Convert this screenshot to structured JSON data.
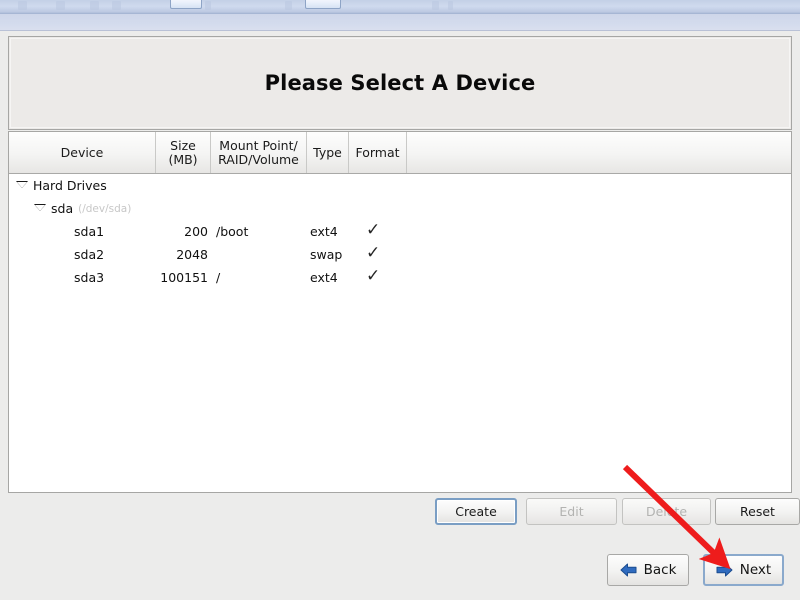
{
  "window": {
    "title": "Please Select A Device"
  },
  "chrome": {
    "present": true
  },
  "table": {
    "columns": [
      {
        "label": "Device",
        "key": "device"
      },
      {
        "label": "Size\n(MB)",
        "line1": "Size",
        "line2": "(MB)",
        "key": "size"
      },
      {
        "label": "Mount Point/\nRAID/Volume",
        "line1": "Mount Point/",
        "line2": "RAID/Volume",
        "key": "mount"
      },
      {
        "label": "Type",
        "key": "type"
      },
      {
        "label": "Format",
        "key": "format"
      }
    ],
    "rows": [
      {
        "kind": "group",
        "indent": 0,
        "expanded": true,
        "device": "Hard Drives",
        "path": "",
        "size": "",
        "mount": "",
        "type": "",
        "format": ""
      },
      {
        "kind": "disk",
        "indent": 1,
        "expanded": true,
        "device": "sda",
        "path": "(/dev/sda)",
        "size": "",
        "mount": "",
        "type": "",
        "format": ""
      },
      {
        "kind": "partition",
        "indent": 2,
        "expanded": null,
        "device": "sda1",
        "path": "",
        "size": "200",
        "mount": "/boot",
        "type": "ext4",
        "format": "✓"
      },
      {
        "kind": "partition",
        "indent": 2,
        "expanded": null,
        "device": "sda2",
        "path": "",
        "size": "2048",
        "mount": "",
        "type": "swap",
        "format": "✓"
      },
      {
        "kind": "partition",
        "indent": 2,
        "expanded": null,
        "device": "sda3",
        "path": "",
        "size": "100151",
        "mount": "/",
        "type": "ext4",
        "format": "✓"
      }
    ]
  },
  "actions": {
    "create": "Create",
    "edit": "Edit",
    "delete": "Delete",
    "reset": "Reset",
    "create_focused": true,
    "edit_disabled": true,
    "delete_disabled": true
  },
  "navigation": {
    "back": "Back",
    "next": "Next",
    "back_icon": "arrow-left-icon",
    "next_icon": "arrow-right-icon",
    "next_focused": true
  },
  "annotation": {
    "type": "arrow",
    "color": "#ee1c1c",
    "points_to": "next-button"
  },
  "colors": {
    "accent_blue": "#2b5fad",
    "arrow_blue": "#2f6bbf",
    "panel_bg": "#eceae8",
    "page_bg": "#ececeb",
    "chrome_blue": "#ced6ea",
    "annotation_red": "#ee1c1c",
    "disabled_text": "#b3b3b1",
    "path_gray": "#c7c7c7"
  }
}
